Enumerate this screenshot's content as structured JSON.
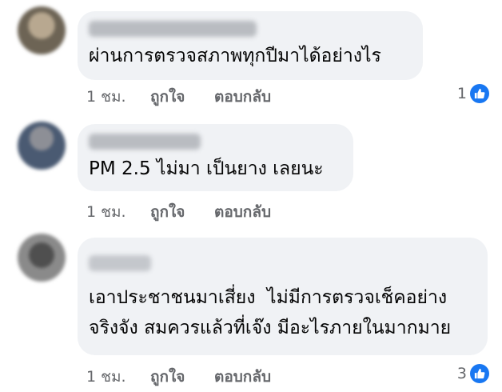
{
  "comments": [
    {
      "text": "ผ่านการตรวจสภาพทุกปีมาได้อย่างไร",
      "time": "1 ชม.",
      "like_label": "ถูกใจ",
      "reply_label": "ตอบกลับ",
      "reaction_count": "1"
    },
    {
      "text": "PM 2.5 ไม่มา เป็นยาง เลยนะ",
      "time": "1 ชม.",
      "like_label": "ถูกใจ",
      "reply_label": "ตอบกลับ"
    },
    {
      "text": "เอาประชาชนมาเสี่ยง  ไม่มีการตรวจเช็คอย่าง\nจริงจัง สมควรแล้วที่เจ๊ง มีอะไรภายในมากมาย",
      "time": "1 ชม.",
      "like_label": "ถูกใจ",
      "reply_label": "ตอบกลับ",
      "reaction_count": "3"
    }
  ],
  "colors": {
    "bubble": "#f0f2f5",
    "secondary_text": "#65676b",
    "like_blue": "#1877f2"
  },
  "icons": [
    "avatar-blurred",
    "like-reaction-icon"
  ]
}
